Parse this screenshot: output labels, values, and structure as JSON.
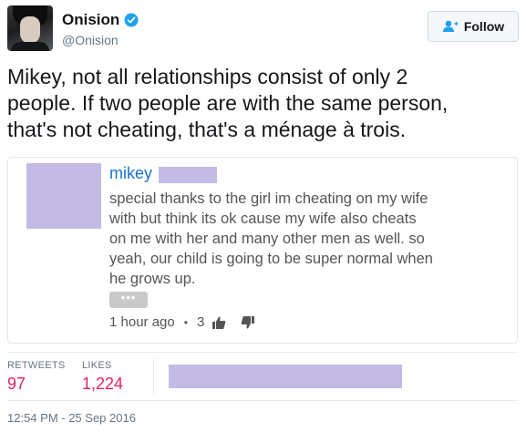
{
  "author": {
    "display_name": "Onision",
    "handle": "@Onision",
    "verified": true
  },
  "follow_button": {
    "label": "Follow",
    "icon": "add-user-icon"
  },
  "tweet": {
    "lines": [
      "Mikey, not all relationships consist of only 2",
      "people. If two people are with the same person,",
      "that's not cheating, that's a ménage à trois."
    ]
  },
  "quoted_comment": {
    "author": "mikey",
    "lines": [
      "special thanks to the girl im cheating on my wife",
      "with but think its ok cause my wife also cheats",
      "on me with her and many other men as well. so",
      "yeah, our child is going to be super normal when",
      "he grows up."
    ],
    "more_label": "•••",
    "time": "1 hour ago",
    "separator": "•",
    "likes": "3",
    "icons": [
      "thumbs-up-icon",
      "thumbs-down-icon"
    ]
  },
  "stats": {
    "retweets_label": "RETWEETS",
    "retweets_value": "97",
    "likes_label": "LIKES",
    "likes_value": "1,224"
  },
  "timestamp": "12:54 PM - 25 Sep 2016",
  "colors": {
    "accent_blue": "#1a73c9",
    "verified_blue": "#1da1f2",
    "stat_value": "#e0245e",
    "redaction": "#c3bbe6"
  }
}
